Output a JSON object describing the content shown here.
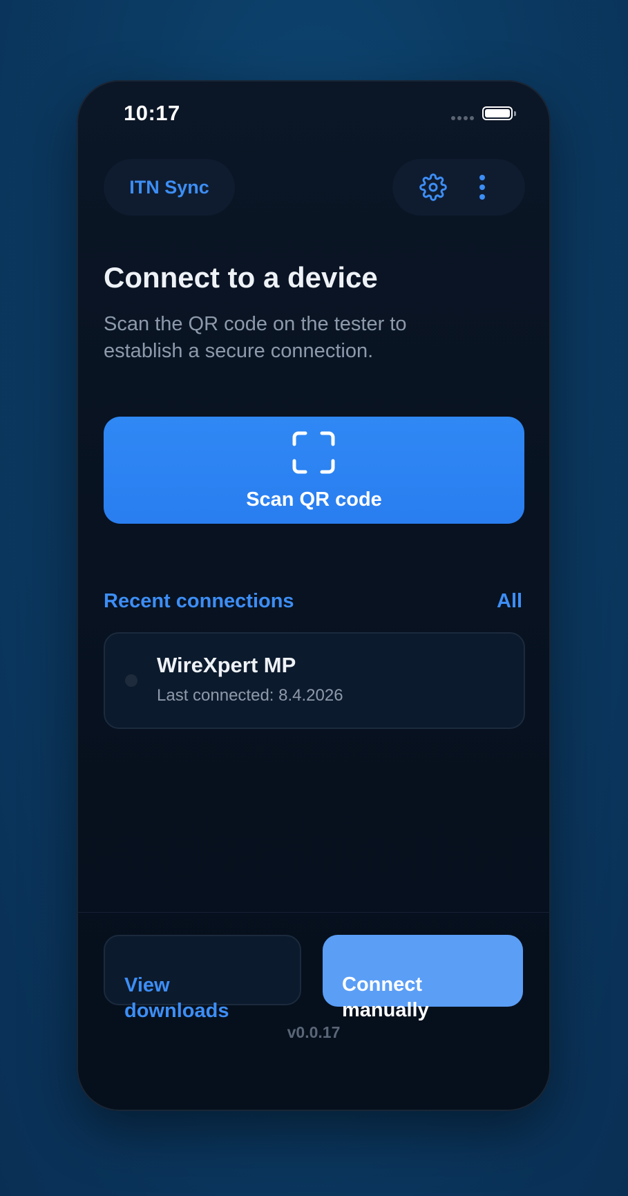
{
  "status_bar": {
    "time": "10:17"
  },
  "header": {
    "app_name": "ITN Sync",
    "settings_icon": "gear-icon",
    "menu_icon": "more-vertical-icon"
  },
  "main": {
    "title": "Connect to a device",
    "subtitle": "Scan the QR code on the tester to establish a secure connection.",
    "scan_button": {
      "icon": "qr-scan-icon",
      "label": "Scan QR code"
    }
  },
  "recent": {
    "title": "Recent connections",
    "all_label": "All",
    "items": [
      {
        "name": "WireXpert MP",
        "subtitle": "Last connected: 8.4.2026"
      }
    ]
  },
  "footer": {
    "view_downloads_label": "View\ndownloads",
    "connect_manually_label": "Connect\nmanually",
    "version": "v0.0.17"
  },
  "colors": {
    "accent": "#3d8ef5",
    "primary_button": "#2f88f4",
    "secondary_button": "#5b9ef6",
    "background": "#07111f"
  }
}
